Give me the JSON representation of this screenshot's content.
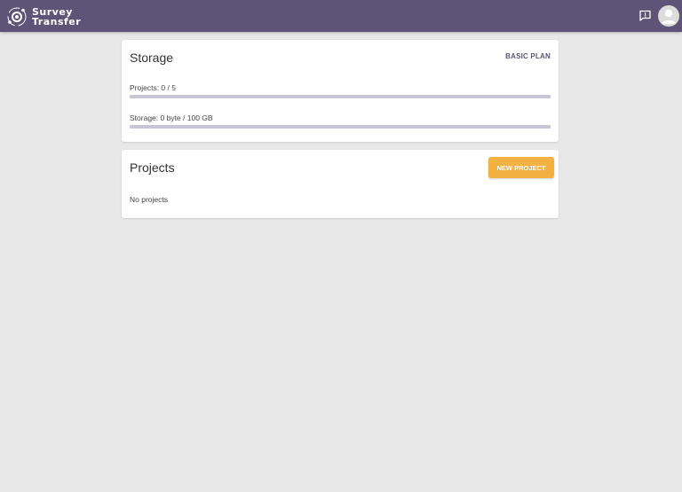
{
  "app": {
    "logo_line1": "Survey",
    "logo_line2": "Transfer",
    "logo_icon": "orbit-logo-icon",
    "feedback_icon": "feedback-icon",
    "avatar_icon": "user-avatar-icon"
  },
  "colors": {
    "header": "#5d5478",
    "accent": "#f2b141",
    "background": "#e9e8e9",
    "bar_track": "#c9c5d6"
  },
  "storage": {
    "title": "Storage",
    "plan_label": "BASIC PLAN",
    "projects_quota": "Projects: 0 / 5",
    "projects_fraction": 0,
    "storage_quota": "Storage: 0 byte / 100 GB",
    "storage_fraction": 0
  },
  "projects": {
    "title": "Projects",
    "new_button": "NEW PROJECT",
    "empty_message": "No projects"
  }
}
